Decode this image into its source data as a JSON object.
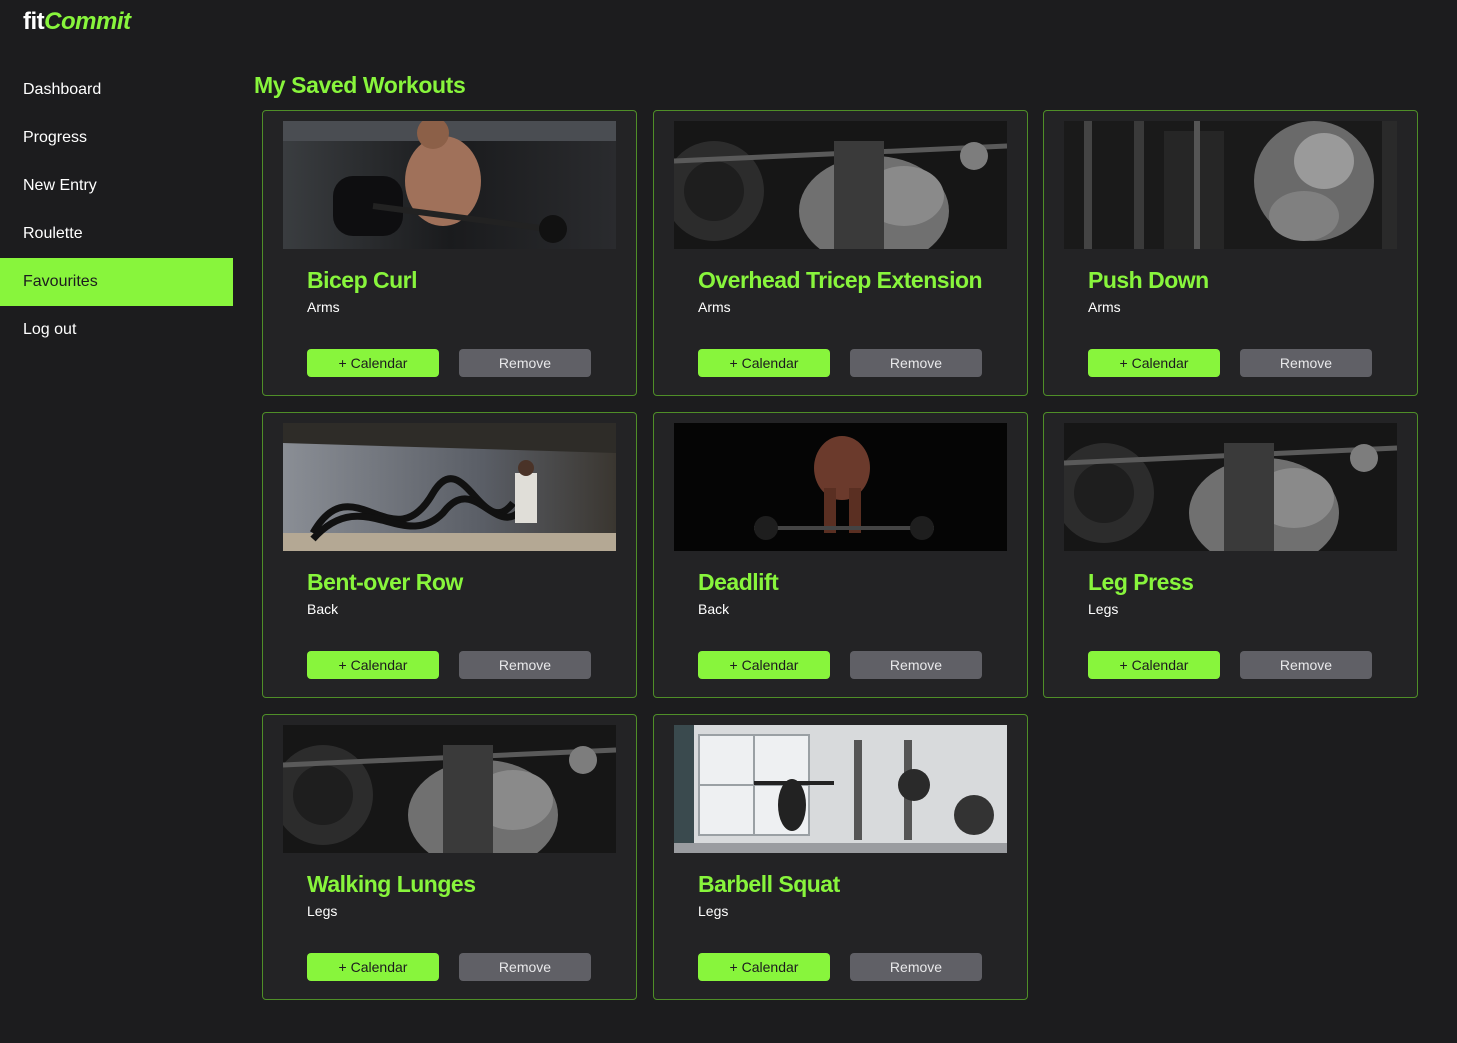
{
  "brand": {
    "part1": "fit",
    "part2": "Commit"
  },
  "sidebar": {
    "items": [
      {
        "label": "Dashboard",
        "active": false
      },
      {
        "label": "Progress",
        "active": false
      },
      {
        "label": "New Entry",
        "active": false
      },
      {
        "label": "Roulette",
        "active": false
      },
      {
        "label": "Favourites",
        "active": true
      },
      {
        "label": "Log out",
        "active": false
      }
    ]
  },
  "page": {
    "title": "My Saved Workouts"
  },
  "colors": {
    "accent": "#88f53c",
    "background": "#1c1c1e",
    "card": "#232325",
    "card_border": "#4f8e28",
    "secondary_button": "#606066"
  },
  "workouts": [
    {
      "name": "Bicep Curl",
      "category": "Arms",
      "image": "bicep-curl-photo",
      "calendar_label": "+ Calendar",
      "remove_label": "Remove"
    },
    {
      "name": "Overhead Tricep Extension",
      "category": "Arms",
      "image": "barbell-back-photo",
      "calendar_label": "+ Calendar",
      "remove_label": "Remove"
    },
    {
      "name": "Push Down",
      "category": "Arms",
      "image": "cable-pushdown-photo",
      "calendar_label": "+ Calendar",
      "remove_label": "Remove"
    },
    {
      "name": "Bent-over Row",
      "category": "Back",
      "image": "battle-ropes-photo",
      "calendar_label": "+ Calendar",
      "remove_label": "Remove"
    },
    {
      "name": "Deadlift",
      "category": "Back",
      "image": "deadlift-photo",
      "calendar_label": "+ Calendar",
      "remove_label": "Remove"
    },
    {
      "name": "Leg Press",
      "category": "Legs",
      "image": "barbell-back-photo",
      "calendar_label": "+ Calendar",
      "remove_label": "Remove"
    },
    {
      "name": "Walking Lunges",
      "category": "Legs",
      "image": "barbell-back-photo",
      "calendar_label": "+ Calendar",
      "remove_label": "Remove"
    },
    {
      "name": "Barbell Squat",
      "category": "Legs",
      "image": "squat-gym-photo",
      "calendar_label": "+ Calendar",
      "remove_label": "Remove"
    }
  ]
}
